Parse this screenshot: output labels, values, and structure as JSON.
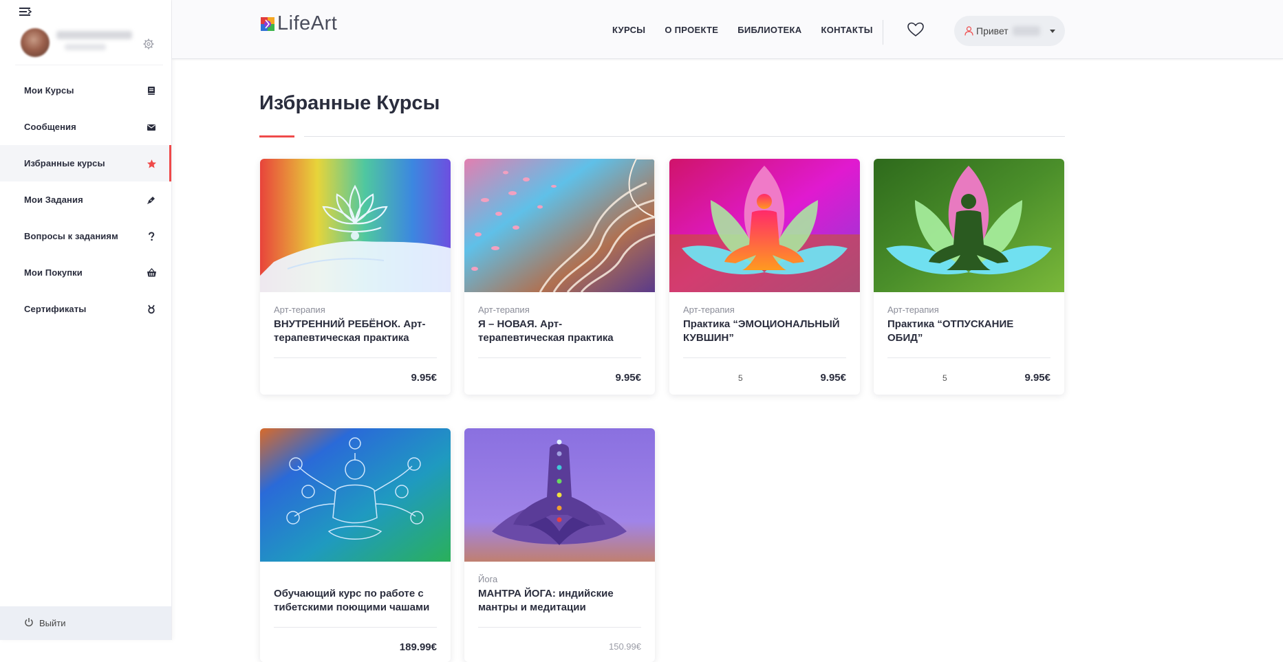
{
  "sidebar": {
    "menu": [
      {
        "label": "Мои Курсы",
        "icon": "book-icon"
      },
      {
        "label": "Сообщения",
        "icon": "envelope-icon"
      },
      {
        "label": "Избранные курсы",
        "icon": "star-icon",
        "active": true
      },
      {
        "label": "Мои Задания",
        "icon": "pen-icon"
      },
      {
        "label": "Вопросы к заданиям",
        "icon": "question-icon"
      },
      {
        "label": "Мои Покупки",
        "icon": "basket-icon"
      },
      {
        "label": "Сертификаты",
        "icon": "certificate-icon"
      }
    ],
    "logout_label": "Выйти"
  },
  "header": {
    "logo_text": "LifeArt",
    "nav": [
      "КУРСЫ",
      "О ПРОЕКТЕ",
      "БИБЛИОТЕКА",
      "КОНТАКТЫ"
    ],
    "greeting": "Привет"
  },
  "main": {
    "title": "Избранные Курсы",
    "courses": [
      {
        "category": "Арт-терапия",
        "title": "ВНУТРЕННИЙ РЕБЁНОК. Арт-терапевтическая практика",
        "rating": "",
        "price": "9.95€"
      },
      {
        "category": "Арт-терапия",
        "title": "Я – НОВАЯ. Арт-терапевтическая практика",
        "rating": "",
        "price": "9.95€"
      },
      {
        "category": "Арт-терапия",
        "title": "Практика “ЭМОЦИОНАЛЬНЫЙ КУВШИН”",
        "rating": "5",
        "price": "9.95€"
      },
      {
        "category": "Арт-терапия",
        "title": "Практика “ОТПУСКАНИЕ ОБИД”",
        "rating": "5",
        "price": "9.95€"
      },
      {
        "category": "",
        "title": "Обучающий курс по работе с тибетскими поющими чашами",
        "rating": "",
        "price": "189.99€"
      },
      {
        "category": "Йога",
        "title": "МАНТРА ЙОГА: индийские мантры и медитации",
        "rating": "",
        "price": "150.99€"
      }
    ]
  },
  "colors": {
    "accent": "#ef4a4a",
    "text": "#2a2d3d"
  }
}
